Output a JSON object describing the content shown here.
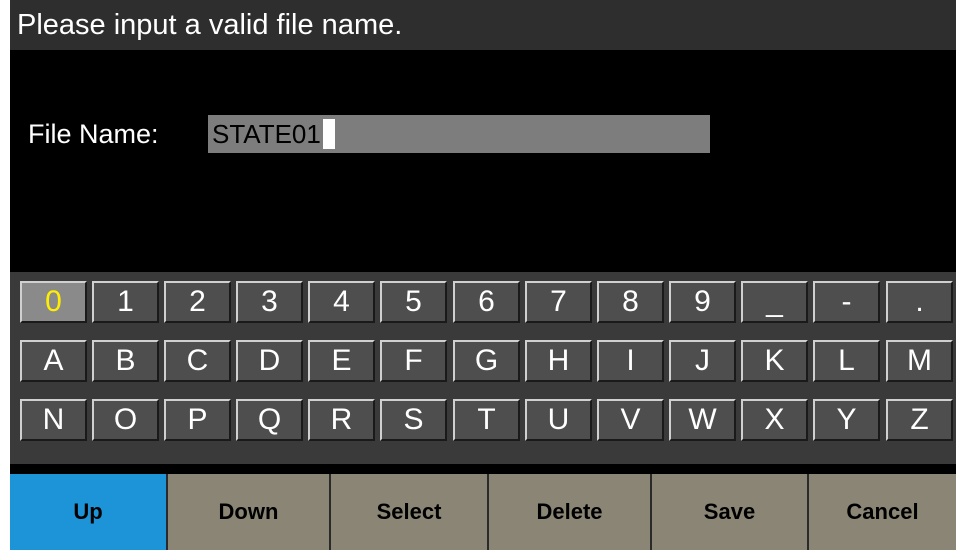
{
  "title": "Please input a valid file name.",
  "file_name": {
    "label": "File Name:",
    "value": "STATE01"
  },
  "keyboard": {
    "selected": "0",
    "rows": [
      [
        "0",
        "1",
        "2",
        "3",
        "4",
        "5",
        "6",
        "7",
        "8",
        "9",
        "_",
        "-",
        "."
      ],
      [
        "A",
        "B",
        "C",
        "D",
        "E",
        "F",
        "G",
        "H",
        "I",
        "J",
        "K",
        "L",
        "M"
      ],
      [
        "N",
        "O",
        "P",
        "Q",
        "R",
        "S",
        "T",
        "U",
        "V",
        "W",
        "X",
        "Y",
        "Z"
      ]
    ]
  },
  "softkeys": [
    {
      "label": "Up",
      "active": true
    },
    {
      "label": "Down",
      "active": false
    },
    {
      "label": "Select",
      "active": false
    },
    {
      "label": "Delete",
      "active": false
    },
    {
      "label": "Save",
      "active": false
    },
    {
      "label": "Cancel",
      "active": false
    }
  ],
  "colors": {
    "title_bar": "#2e2e2e",
    "input_field": "#7d7d7d",
    "key": "#4e4e4e",
    "selected_key_text": "#ffee00",
    "softkey": "#8a8575",
    "softkey_active": "#1e94d8"
  }
}
